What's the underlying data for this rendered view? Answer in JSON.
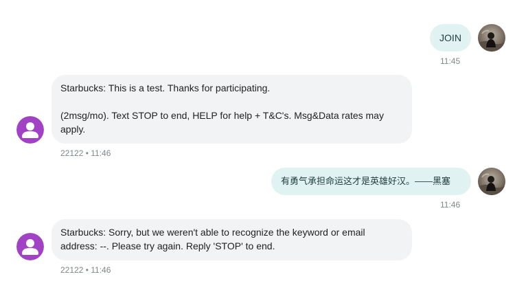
{
  "messages": [
    {
      "direction": "outgoing",
      "text": "JOIN",
      "time": "11:45",
      "avatar_icon": "user-photo-avatar"
    },
    {
      "direction": "incoming",
      "line1": "Starbucks: This is a test. Thanks for participating.",
      "line2": "(2msg/mo). Text STOP to end, HELP for help + T&C's. Msg&Data rates may apply.",
      "meta": "22122 • 11:46",
      "avatar_icon": "person-icon"
    },
    {
      "direction": "outgoing",
      "text": "有勇气承担命运这才是英雄好汉。——黑塞",
      "time": "11:46",
      "avatar_icon": "user-photo-avatar"
    },
    {
      "direction": "incoming",
      "text": "Starbucks: Sorry, but we weren't able to recognize the keyword or email address: --. Please try again. Reply 'STOP' to end.",
      "meta": "22122 • 11:46",
      "avatar_icon": "person-icon"
    }
  ],
  "colors": {
    "outgoing_bubble": "#e1f2f2",
    "incoming_bubble": "#f1f3f4",
    "contact_avatar": "#a142c4",
    "timestamp": "#80868b"
  }
}
